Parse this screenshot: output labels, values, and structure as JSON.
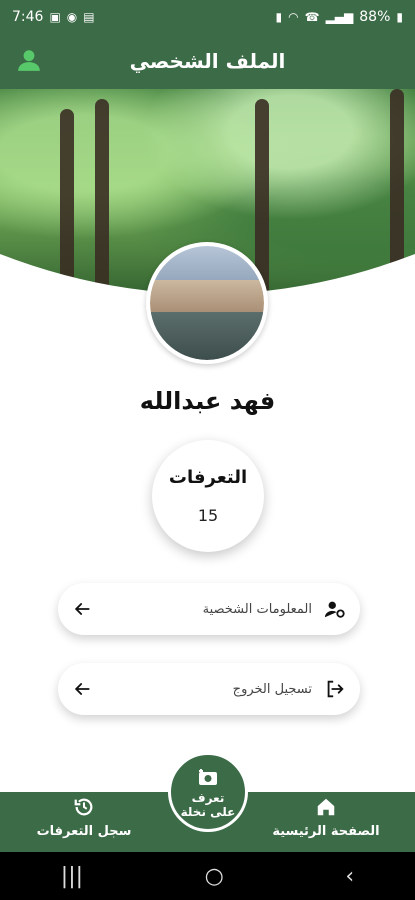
{
  "status_bar": {
    "time": "7:46",
    "battery": "88%"
  },
  "app_bar": {
    "title": "الملف الشخصي"
  },
  "profile": {
    "name": "فهد عبدالله",
    "stats": {
      "title": "التعرفات",
      "value": "15"
    }
  },
  "menu": [
    {
      "label": "المعلومات الشخصية",
      "icon": "user-gear-icon"
    },
    {
      "label": "تسجيل الخروج",
      "icon": "logout-icon"
    }
  ],
  "bottom_nav": {
    "home": {
      "label": "الصفحة الرئيسية",
      "icon": "home-icon"
    },
    "history": {
      "label": "سجل التعرفات",
      "icon": "history-icon"
    },
    "center": {
      "line1": "تعرف",
      "line2": "على نخلة",
      "icon": "camera-plus-icon"
    }
  },
  "colors": {
    "primary": "#3c6b47",
    "background": "#ffffff",
    "text": "#111111"
  }
}
